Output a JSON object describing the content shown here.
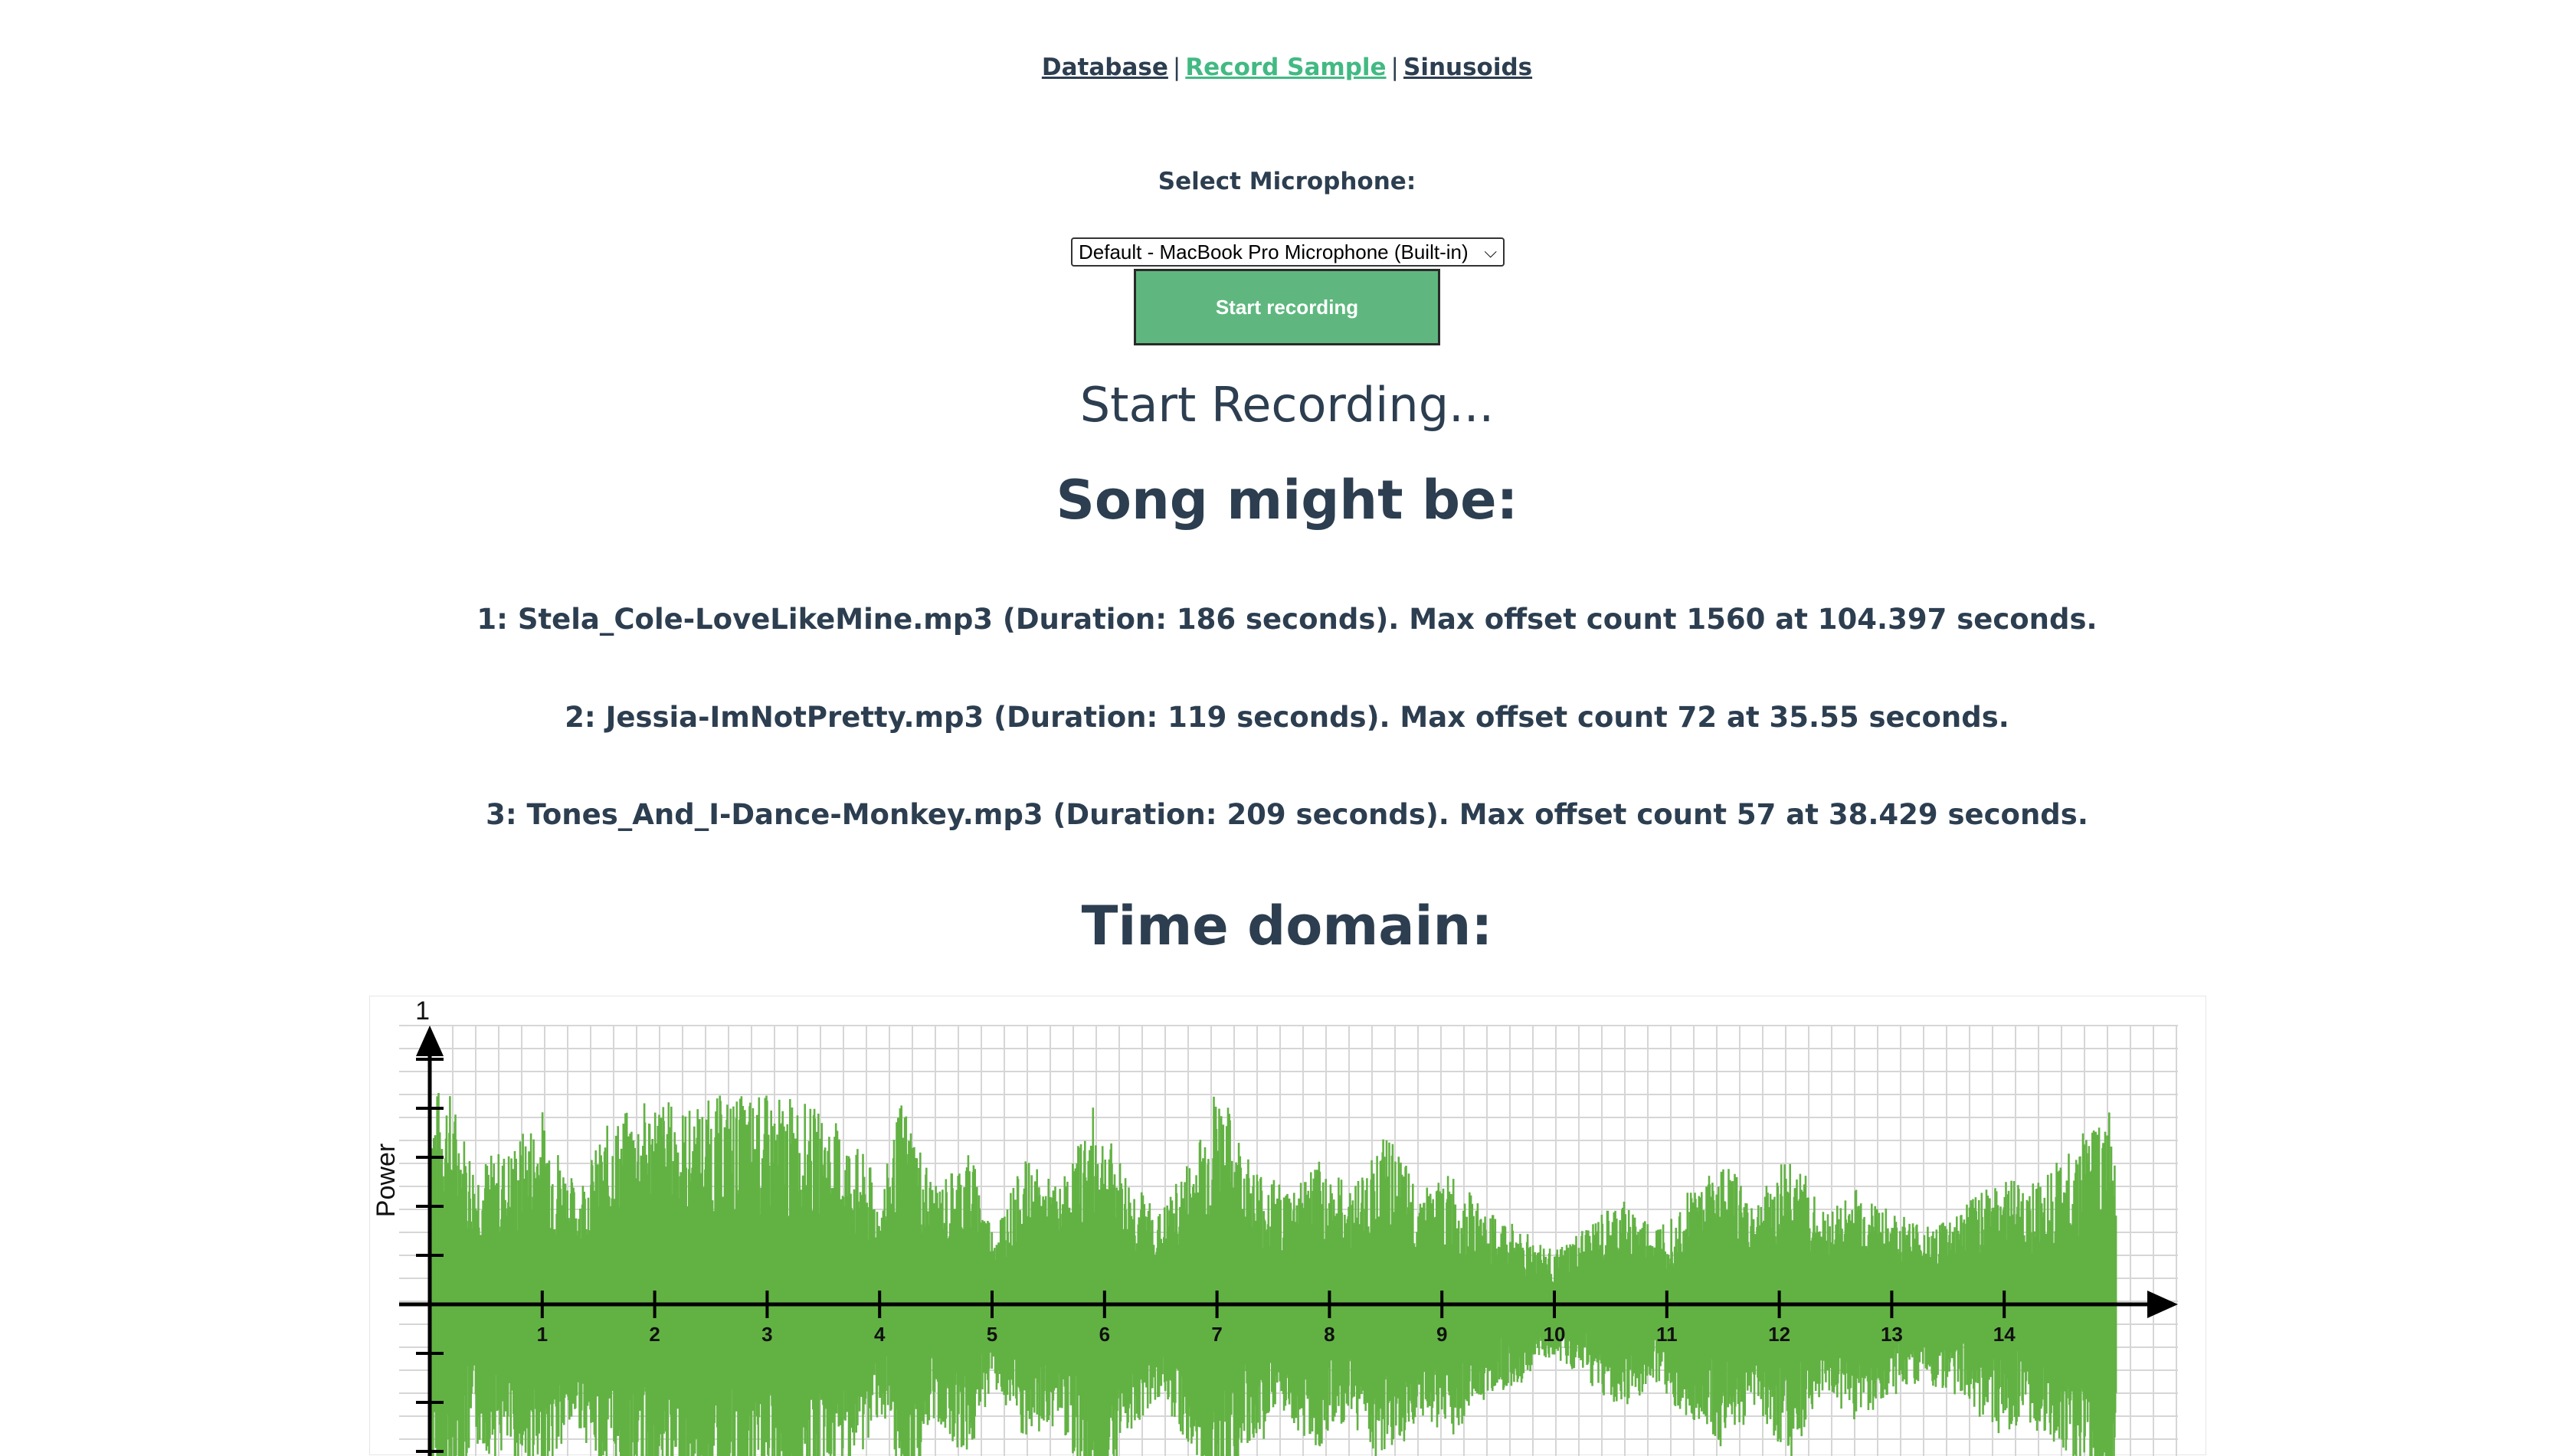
{
  "nav": {
    "items": [
      {
        "label": "Database",
        "active": false
      },
      {
        "label": "Record Sample",
        "active": true
      },
      {
        "label": "Sinusoids",
        "active": false
      }
    ],
    "separator": "|"
  },
  "microphone": {
    "label": "Select Microphone:",
    "selected": "Default - MacBook Pro Microphone (Built-in)"
  },
  "record_button": {
    "label": "Start recording"
  },
  "status_text": "Start Recording...",
  "results": {
    "heading": "Song might be:",
    "items": [
      "1: Stela_Cole-LoveLikeMine.mp3 (Duration: 186 seconds). Max offset count 1560 at 104.397 seconds.",
      "2: Jessia-ImNotPretty.mp3 (Duration: 119 seconds). Max offset count 72 at 35.55 seconds.",
      "3: Tones_And_I-Dance-Monkey.mp3 (Duration: 209 seconds). Max offset count 57 at 38.429 seconds."
    ]
  },
  "time_domain": {
    "heading": "Time domain:"
  },
  "colors": {
    "text": "#2c3e50",
    "active_link": "#42b983",
    "button": "#5fb77f",
    "waveform": "#62b243"
  },
  "chart_data": {
    "type": "area",
    "ylabel": "Power",
    "y_top_label": "1",
    "x_ticks": [
      "1",
      "2",
      "3",
      "4",
      "5",
      "6",
      "7",
      "8",
      "9",
      "10",
      "11",
      "12",
      "13",
      "14"
    ],
    "xlim": [
      0,
      15
    ],
    "ylim": [
      -1,
      1
    ],
    "grid": true,
    "envelope": {
      "x": [
        0.0,
        0.15,
        0.4,
        0.7,
        1.0,
        1.3,
        1.6,
        2.0,
        2.3,
        2.6,
        3.0,
        3.3,
        3.6,
        3.9,
        4.0,
        4.2,
        4.5,
        4.8,
        5.0,
        5.3,
        5.6,
        5.9,
        6.2,
        6.5,
        6.8,
        7.0,
        7.3,
        7.6,
        7.9,
        8.2,
        8.5,
        8.8,
        9.1,
        9.4,
        9.7,
        10.0,
        10.3,
        10.6,
        10.9,
        11.2,
        11.5,
        11.8,
        12.1,
        12.4,
        12.7,
        13.0,
        13.3,
        13.6,
        13.9,
        14.2,
        14.5,
        14.8,
        15.0
      ],
      "y": [
        0.8,
        0.85,
        0.55,
        0.6,
        0.75,
        0.45,
        0.7,
        0.8,
        0.75,
        0.8,
        0.8,
        0.78,
        0.7,
        0.55,
        0.4,
        0.8,
        0.45,
        0.6,
        0.3,
        0.55,
        0.45,
        0.75,
        0.5,
        0.35,
        0.6,
        0.85,
        0.55,
        0.45,
        0.55,
        0.45,
        0.65,
        0.45,
        0.5,
        0.35,
        0.3,
        0.2,
        0.3,
        0.4,
        0.3,
        0.45,
        0.55,
        0.4,
        0.6,
        0.35,
        0.45,
        0.35,
        0.3,
        0.35,
        0.5,
        0.45,
        0.55,
        0.7,
        0.75
      ]
    }
  }
}
